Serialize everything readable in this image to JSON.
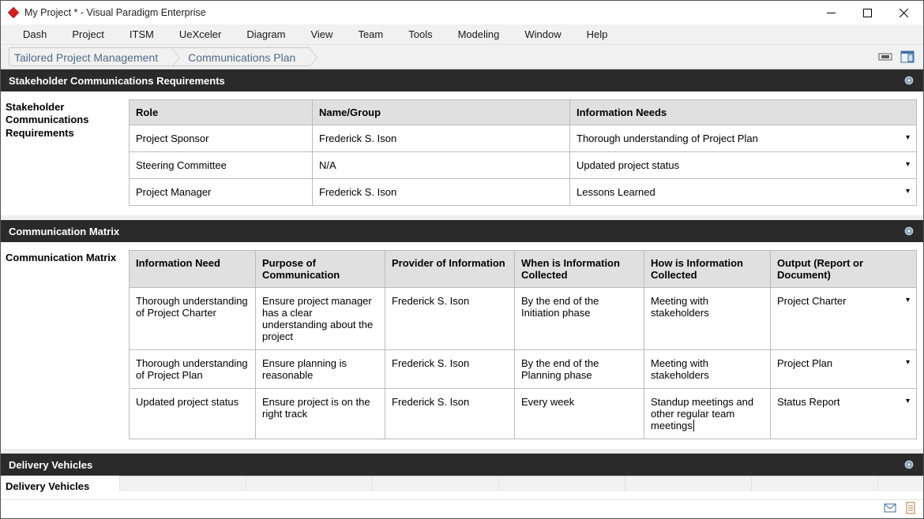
{
  "window": {
    "title": "My Project * - Visual Paradigm Enterprise"
  },
  "menu": [
    "Dash",
    "Project",
    "ITSM",
    "UeXceler",
    "Diagram",
    "View",
    "Team",
    "Tools",
    "Modeling",
    "Window",
    "Help"
  ],
  "breadcrumb": [
    "Tailored Project Management",
    "Communications Plan"
  ],
  "sections": {
    "stakeholder": {
      "title": "Stakeholder Communications Requirements",
      "label": "Stakeholder Communications Requirements",
      "cols": [
        "Role",
        "Name/Group",
        "Information Needs"
      ],
      "rows": [
        {
          "role": "Project Sponsor",
          "name": "Frederick S. Ison",
          "info": "Thorough understanding of Project Plan"
        },
        {
          "role": "Steering Committee",
          "name": "N/A",
          "info": "Updated project status"
        },
        {
          "role": "Project Manager",
          "name": "Frederick S. Ison",
          "info": "Lessons Learned"
        }
      ]
    },
    "matrix": {
      "title": "Communication Matrix",
      "label": "Communication Matrix",
      "cols": [
        "Information Need",
        "Purpose of Communication",
        "Provider of Information",
        "When is Information Collected",
        "How is Information Collected",
        "Output (Report or Document)"
      ],
      "rows": [
        {
          "c0": "Thorough understanding of Project Charter",
          "c1": "Ensure project manager has a clear understanding about the project",
          "c2": "Frederick S. Ison",
          "c3": "By the end of the Initiation phase",
          "c4": "Meeting with stakeholders",
          "c5": "Project Charter"
        },
        {
          "c0": "Thorough understanding of Project Plan",
          "c1": "Ensure planning is reasonable",
          "c2": "Frederick S. Ison",
          "c3": "By the end of the Planning phase",
          "c4": "Meeting with stakeholders",
          "c5": "Project Plan"
        },
        {
          "c0": "Updated project status",
          "c1": "Ensure project is on the right track",
          "c2": "Frederick S. Ison",
          "c3": "Every week",
          "c4": "Standup meetings and other regular team meetings",
          "c5": "Status Report"
        }
      ]
    },
    "delivery": {
      "title": "Delivery Vehicles",
      "label": "Delivery Vehicles"
    }
  }
}
